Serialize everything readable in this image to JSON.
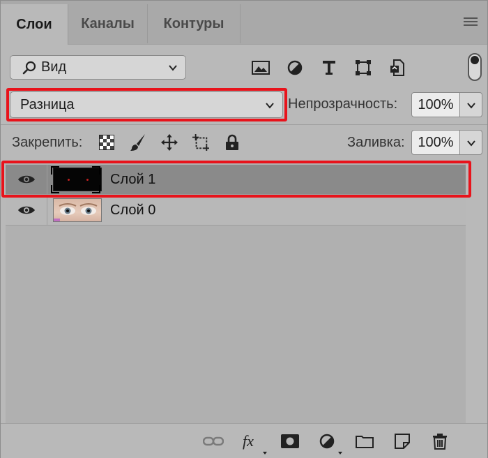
{
  "tabs": [
    {
      "label": "Слои",
      "active": true
    },
    {
      "label": "Каналы",
      "active": false
    },
    {
      "label": "Контуры",
      "active": false
    }
  ],
  "filter": {
    "label": "Вид",
    "icons": [
      "image-filter-icon",
      "adjustment-filter-icon",
      "type-filter-icon",
      "shape-filter-icon",
      "smart-object-filter-icon"
    ]
  },
  "blend": {
    "mode": "Разница",
    "opacity_label": "Непрозрачность:",
    "opacity_value": "100%"
  },
  "lock": {
    "label": "Закрепить:",
    "icons": [
      "lock-transparency-icon",
      "lock-pixels-icon",
      "lock-position-icon",
      "lock-artboard-icon",
      "lock-all-icon"
    ],
    "fill_label": "Заливка:",
    "fill_value": "100%"
  },
  "layers": [
    {
      "name": "Слой 1",
      "selected": true,
      "visible": true
    },
    {
      "name": "Слой 0",
      "selected": false,
      "visible": true
    }
  ],
  "bottom_icons": [
    "link-icon",
    "fx-icon",
    "mask-icon",
    "adjustment-layer-icon",
    "group-folder-icon",
    "new-layer-icon",
    "trash-icon"
  ],
  "colors": {
    "highlight": "#e8131b",
    "panel": "#b9b9b9",
    "selected_row": "#8a8a8a"
  }
}
